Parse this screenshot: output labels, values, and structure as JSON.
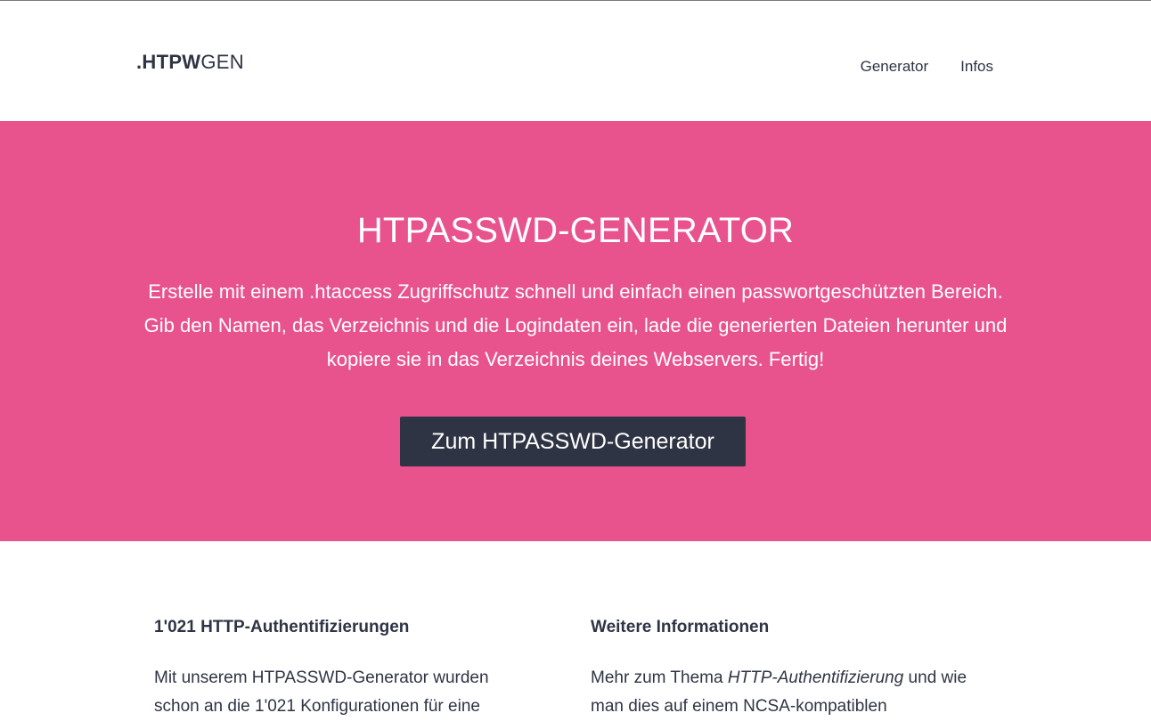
{
  "header": {
    "logo_bold": ".HTPW",
    "logo_light": "GEN",
    "nav": [
      {
        "label": "Generator"
      },
      {
        "label": "Infos"
      }
    ]
  },
  "hero": {
    "title": "HTPASSWD-GENERATOR",
    "description": "Erstelle mit einem .htaccess Zugriffschutz schnell und einfach einen passwortgeschützten Bereich. Gib den Namen, das Verzeichnis und die Logindaten ein, lade die generierten Dateien herunter und kopiere sie in das Verzeichnis deines Webservers. Fertig!",
    "cta_label": "Zum HTPASSWD-Generator"
  },
  "stats": {
    "heading": "1'021 HTTP-Authentifizierungen",
    "text": "Mit unserem HTPASSWD-Generator wurden schon an die 1'021 Konfigurationen für eine"
  },
  "info": {
    "heading": "Weitere Informationen",
    "text_before": "Mehr zum Thema ",
    "text_em": "HTTP-Authentifizierung",
    "text_after": " und wie man dies auf einem NCSA-kompatiblen"
  },
  "colors": {
    "accent": "#e8538e",
    "dark": "#2f3444"
  }
}
